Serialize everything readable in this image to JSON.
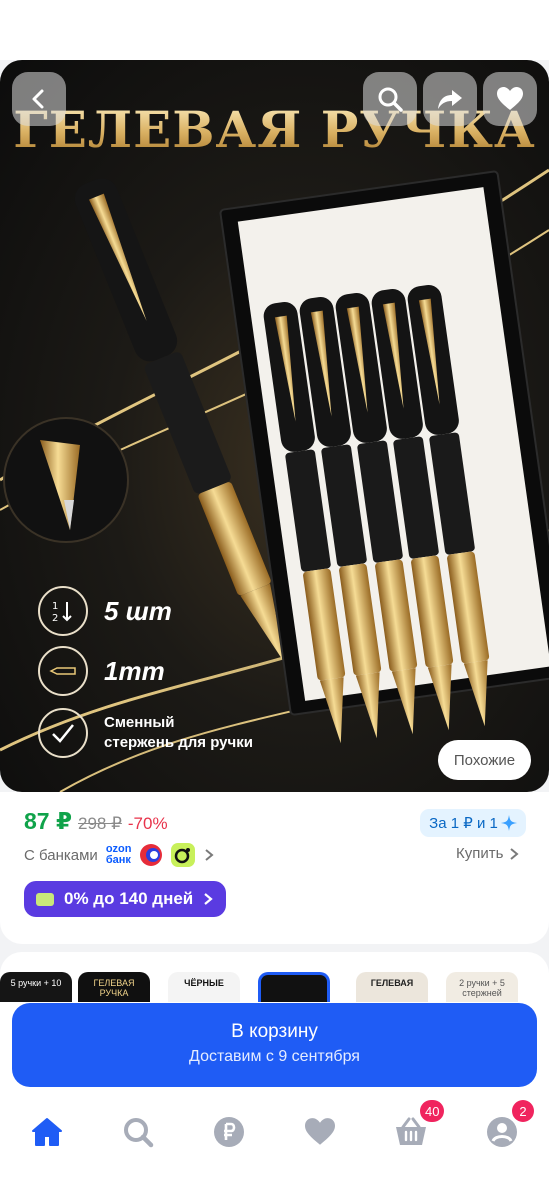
{
  "product_image": {
    "title": "ГЕЛЕВАЯ РУЧКА",
    "features": [
      {
        "icon": "sort-numbers-icon",
        "text": "5 шт"
      },
      {
        "icon": "pen-tip-icon",
        "text": "1mm"
      },
      {
        "icon": "checkmark-icon",
        "line1": "Сменный",
        "line2": "стержень для ручки"
      }
    ],
    "similar_label": "Похожие"
  },
  "toolbar": {
    "back_icon": "chevron-left-icon",
    "search_icon": "search-icon",
    "share_icon": "share-icon",
    "favorite_icon": "heart-icon"
  },
  "price": {
    "current": "87 ₽",
    "old": "298 ₽",
    "discount": "-70%",
    "bonus": "За 1 ₽ и 1",
    "banks_label": "С банками",
    "ozon_bank_line1": "ozon",
    "ozon_bank_line2": "банк",
    "buy_label": "Купить",
    "installment": "0% до 140 дней"
  },
  "variants": [
    {
      "label": "5 ручки + 10"
    },
    {
      "label": "ГЕЛЕВАЯ РУЧКА"
    },
    {
      "label": "ЧЁРНЫЕ"
    },
    {
      "label": ""
    },
    {
      "label": "ГЕЛЕВАЯ"
    },
    {
      "label": "2 ручки + 5 стержней"
    }
  ],
  "cart": {
    "label": "В корзину",
    "delivery": "Доставим с 9 сентября"
  },
  "nav": {
    "cart_badge": "40",
    "profile_badge": "2"
  },
  "colors": {
    "accent_blue": "#1f5cf5",
    "price_green": "#10a34a",
    "discount_red": "#e8334b",
    "installment_purple": "#5a3be1",
    "badge_pink": "#f0245e"
  }
}
